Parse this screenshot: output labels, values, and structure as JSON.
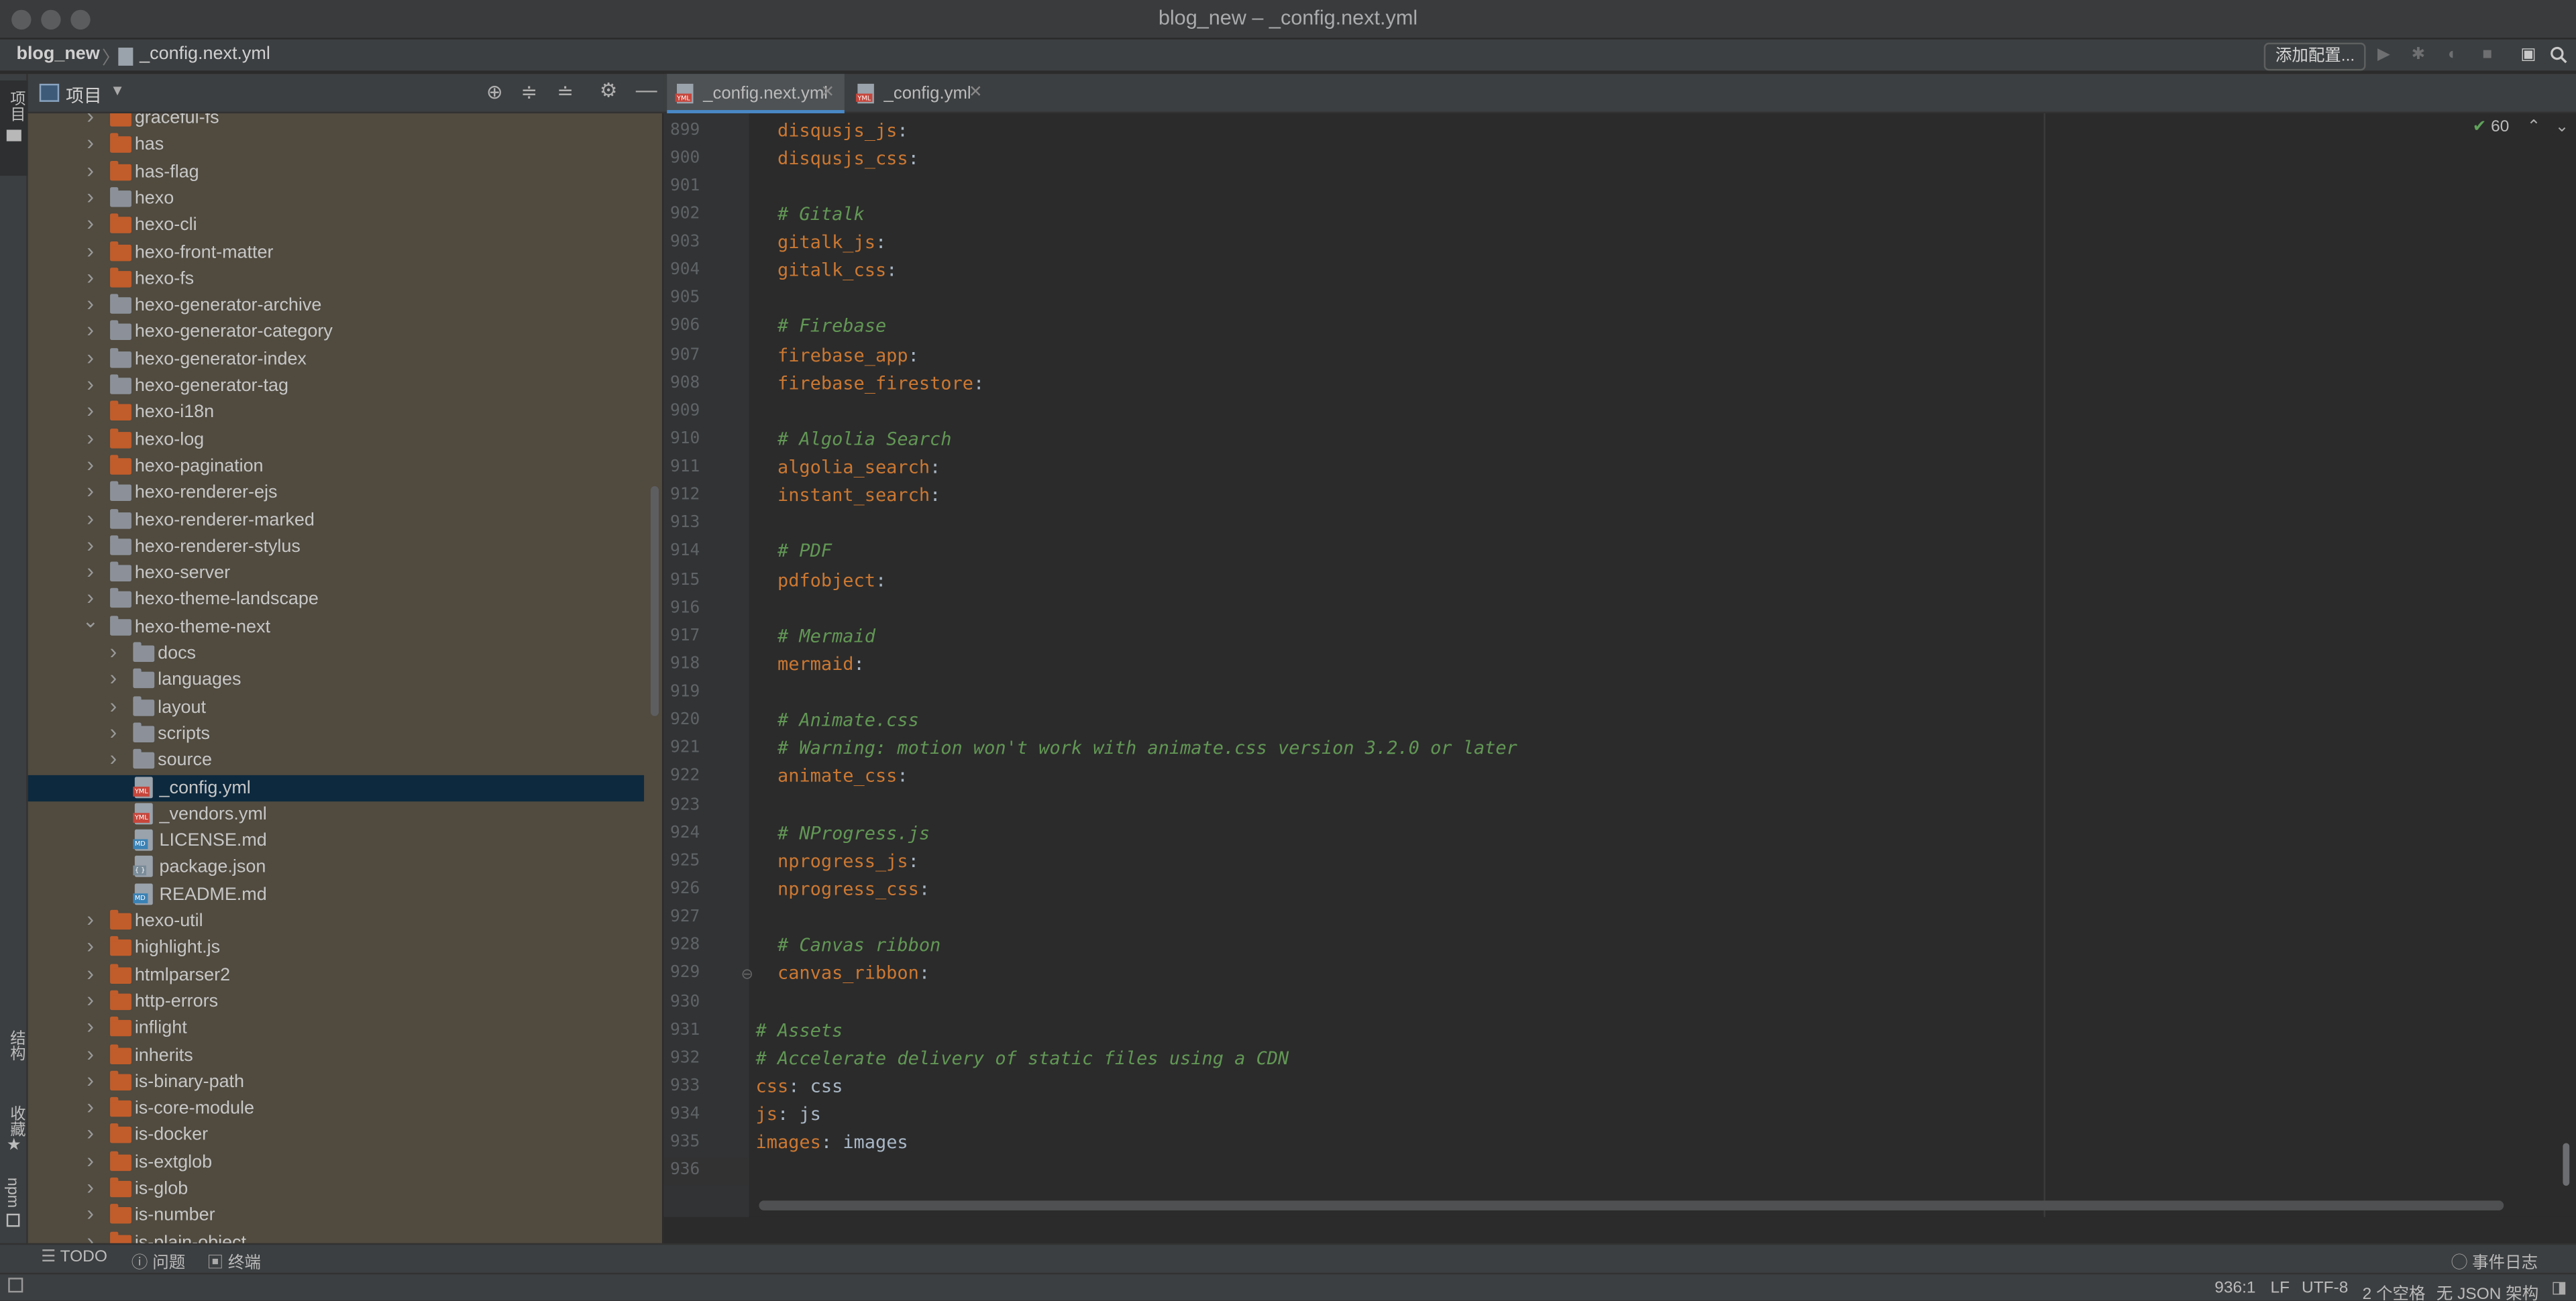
{
  "window": {
    "title": "blog_new – _config.next.yml"
  },
  "breadcrumb": {
    "project": "blog_new",
    "file": "_config.next.yml"
  },
  "toolbar": {
    "add_config": "添加配置..."
  },
  "left_strip": {
    "project_tab": "项目",
    "structure_tab": "结构",
    "favorites_tab": "收藏",
    "npm_tab": "npm"
  },
  "project_panel": {
    "title": "项目",
    "items": [
      {
        "label": "graceful-fs",
        "level": 0,
        "kind": "folder-orange",
        "chevron": "right"
      },
      {
        "label": "has",
        "level": 0,
        "kind": "folder-orange",
        "chevron": "right"
      },
      {
        "label": "has-flag",
        "level": 0,
        "kind": "folder-orange",
        "chevron": "right"
      },
      {
        "label": "hexo",
        "level": 0,
        "kind": "folder-gray",
        "chevron": "right"
      },
      {
        "label": "hexo-cli",
        "level": 0,
        "kind": "folder-orange",
        "chevron": "right"
      },
      {
        "label": "hexo-front-matter",
        "level": 0,
        "kind": "folder-orange",
        "chevron": "right"
      },
      {
        "label": "hexo-fs",
        "level": 0,
        "kind": "folder-orange",
        "chevron": "right"
      },
      {
        "label": "hexo-generator-archive",
        "level": 0,
        "kind": "folder-gray",
        "chevron": "right"
      },
      {
        "label": "hexo-generator-category",
        "level": 0,
        "kind": "folder-gray",
        "chevron": "right"
      },
      {
        "label": "hexo-generator-index",
        "level": 0,
        "kind": "folder-gray",
        "chevron": "right"
      },
      {
        "label": "hexo-generator-tag",
        "level": 0,
        "kind": "folder-gray",
        "chevron": "right"
      },
      {
        "label": "hexo-i18n",
        "level": 0,
        "kind": "folder-orange",
        "chevron": "right"
      },
      {
        "label": "hexo-log",
        "level": 0,
        "kind": "folder-orange",
        "chevron": "right"
      },
      {
        "label": "hexo-pagination",
        "level": 0,
        "kind": "folder-orange",
        "chevron": "right"
      },
      {
        "label": "hexo-renderer-ejs",
        "level": 0,
        "kind": "folder-gray",
        "chevron": "right"
      },
      {
        "label": "hexo-renderer-marked",
        "level": 0,
        "kind": "folder-gray",
        "chevron": "right"
      },
      {
        "label": "hexo-renderer-stylus",
        "level": 0,
        "kind": "folder-gray",
        "chevron": "right"
      },
      {
        "label": "hexo-server",
        "level": 0,
        "kind": "folder-gray",
        "chevron": "right"
      },
      {
        "label": "hexo-theme-landscape",
        "level": 0,
        "kind": "folder-gray",
        "chevron": "right"
      },
      {
        "label": "hexo-theme-next",
        "level": 0,
        "kind": "folder-gray",
        "chevron": "down"
      },
      {
        "label": "docs",
        "level": 1,
        "kind": "folder-gray",
        "chevron": "right"
      },
      {
        "label": "languages",
        "level": 1,
        "kind": "folder-gray",
        "chevron": "right"
      },
      {
        "label": "layout",
        "level": 1,
        "kind": "folder-gray",
        "chevron": "right"
      },
      {
        "label": "scripts",
        "level": 1,
        "kind": "folder-gray",
        "chevron": "right"
      },
      {
        "label": "source",
        "level": 1,
        "kind": "folder-gray",
        "chevron": "right"
      },
      {
        "label": "_config.yml",
        "level": 1,
        "kind": "file-yml",
        "chevron": "none",
        "selected": true
      },
      {
        "label": "_vendors.yml",
        "level": 1,
        "kind": "file-yml",
        "chevron": "none"
      },
      {
        "label": "LICENSE.md",
        "level": 1,
        "kind": "file-md",
        "chevron": "none"
      },
      {
        "label": "package.json",
        "level": 1,
        "kind": "file-json",
        "chevron": "none"
      },
      {
        "label": "README.md",
        "level": 1,
        "kind": "file-md",
        "chevron": "none"
      },
      {
        "label": "hexo-util",
        "level": 0,
        "kind": "folder-orange",
        "chevron": "right"
      },
      {
        "label": "highlight.js",
        "level": 0,
        "kind": "folder-orange",
        "chevron": "right"
      },
      {
        "label": "htmlparser2",
        "level": 0,
        "kind": "folder-orange",
        "chevron": "right"
      },
      {
        "label": "http-errors",
        "level": 0,
        "kind": "folder-orange",
        "chevron": "right"
      },
      {
        "label": "inflight",
        "level": 0,
        "kind": "folder-orange",
        "chevron": "right"
      },
      {
        "label": "inherits",
        "level": 0,
        "kind": "folder-orange",
        "chevron": "right"
      },
      {
        "label": "is-binary-path",
        "level": 0,
        "kind": "folder-orange",
        "chevron": "right"
      },
      {
        "label": "is-core-module",
        "level": 0,
        "kind": "folder-orange",
        "chevron": "right"
      },
      {
        "label": "is-docker",
        "level": 0,
        "kind": "folder-orange",
        "chevron": "right"
      },
      {
        "label": "is-extglob",
        "level": 0,
        "kind": "folder-orange",
        "chevron": "right"
      },
      {
        "label": "is-glob",
        "level": 0,
        "kind": "folder-orange",
        "chevron": "right"
      },
      {
        "label": "is-number",
        "level": 0,
        "kind": "folder-orange",
        "chevron": "right"
      },
      {
        "label": "is-plain-object",
        "level": 0,
        "kind": "folder-orange",
        "chevron": "right"
      }
    ]
  },
  "tabs": [
    {
      "label": "_config.next.yml",
      "active": true
    },
    {
      "label": "_config.yml",
      "active": false
    }
  ],
  "editor": {
    "inspection_count": "60",
    "lines": [
      {
        "n": "899",
        "parts": [
          {
            "t": "  "
          },
          {
            "t": "disqusjs_js",
            "c": "k"
          },
          {
            "t": ":",
            "c": "p"
          }
        ]
      },
      {
        "n": "900",
        "parts": [
          {
            "t": "  "
          },
          {
            "t": "disqusjs_css",
            "c": "k"
          },
          {
            "t": ":",
            "c": "p"
          }
        ]
      },
      {
        "n": "901",
        "parts": []
      },
      {
        "n": "902",
        "parts": [
          {
            "t": "  "
          },
          {
            "t": "# Gitalk",
            "c": "c"
          }
        ]
      },
      {
        "n": "903",
        "parts": [
          {
            "t": "  "
          },
          {
            "t": "gitalk_js",
            "c": "k"
          },
          {
            "t": ":",
            "c": "p"
          }
        ]
      },
      {
        "n": "904",
        "parts": [
          {
            "t": "  "
          },
          {
            "t": "gitalk_css",
            "c": "k"
          },
          {
            "t": ":",
            "c": "p"
          }
        ]
      },
      {
        "n": "905",
        "parts": []
      },
      {
        "n": "906",
        "parts": [
          {
            "t": "  "
          },
          {
            "t": "# Firebase",
            "c": "c"
          }
        ]
      },
      {
        "n": "907",
        "parts": [
          {
            "t": "  "
          },
          {
            "t": "firebase_app",
            "c": "k"
          },
          {
            "t": ":",
            "c": "p"
          }
        ]
      },
      {
        "n": "908",
        "parts": [
          {
            "t": "  "
          },
          {
            "t": "firebase_firestore",
            "c": "k"
          },
          {
            "t": ":",
            "c": "p"
          }
        ]
      },
      {
        "n": "909",
        "parts": []
      },
      {
        "n": "910",
        "parts": [
          {
            "t": "  "
          },
          {
            "t": "# Algolia Search",
            "c": "c"
          }
        ]
      },
      {
        "n": "911",
        "parts": [
          {
            "t": "  "
          },
          {
            "t": "algolia_search",
            "c": "k"
          },
          {
            "t": ":",
            "c": "p"
          }
        ]
      },
      {
        "n": "912",
        "parts": [
          {
            "t": "  "
          },
          {
            "t": "instant_search",
            "c": "k"
          },
          {
            "t": ":",
            "c": "p"
          }
        ]
      },
      {
        "n": "913",
        "parts": []
      },
      {
        "n": "914",
        "parts": [
          {
            "t": "  "
          },
          {
            "t": "# PDF",
            "c": "c"
          }
        ]
      },
      {
        "n": "915",
        "parts": [
          {
            "t": "  "
          },
          {
            "t": "pdfobject",
            "c": "k"
          },
          {
            "t": ":",
            "c": "p"
          }
        ]
      },
      {
        "n": "916",
        "parts": []
      },
      {
        "n": "917",
        "parts": [
          {
            "t": "  "
          },
          {
            "t": "# Mermaid",
            "c": "c"
          }
        ]
      },
      {
        "n": "918",
        "parts": [
          {
            "t": "  "
          },
          {
            "t": "mermaid",
            "c": "k"
          },
          {
            "t": ":",
            "c": "p"
          }
        ]
      },
      {
        "n": "919",
        "parts": []
      },
      {
        "n": "920",
        "parts": [
          {
            "t": "  "
          },
          {
            "t": "# Animate.css",
            "c": "c"
          }
        ]
      },
      {
        "n": "921",
        "parts": [
          {
            "t": "  "
          },
          {
            "t": "# Warning: motion won't work with animate.css version 3.2.0 or later",
            "c": "c"
          }
        ]
      },
      {
        "n": "922",
        "parts": [
          {
            "t": "  "
          },
          {
            "t": "animate_css",
            "c": "k"
          },
          {
            "t": ":",
            "c": "p"
          }
        ]
      },
      {
        "n": "923",
        "parts": []
      },
      {
        "n": "924",
        "parts": [
          {
            "t": "  "
          },
          {
            "t": "# NProgress.js",
            "c": "c"
          }
        ]
      },
      {
        "n": "925",
        "parts": [
          {
            "t": "  "
          },
          {
            "t": "nprogress_js",
            "c": "k"
          },
          {
            "t": ":",
            "c": "p"
          }
        ]
      },
      {
        "n": "926",
        "parts": [
          {
            "t": "  "
          },
          {
            "t": "nprogress_css",
            "c": "k"
          },
          {
            "t": ":",
            "c": "p"
          }
        ]
      },
      {
        "n": "927",
        "parts": []
      },
      {
        "n": "928",
        "parts": [
          {
            "t": "  "
          },
          {
            "t": "# Canvas ribbon",
            "c": "c"
          }
        ]
      },
      {
        "n": "929",
        "parts": [
          {
            "t": "  "
          },
          {
            "t": "canvas_ribbon",
            "c": "k"
          },
          {
            "t": ":",
            "c": "p"
          }
        ]
      },
      {
        "n": "930",
        "parts": []
      },
      {
        "n": "931",
        "parts": [
          {
            "t": "# Assets",
            "c": "c"
          }
        ]
      },
      {
        "n": "932",
        "parts": [
          {
            "t": "# Accelerate delivery of static files using a CDN",
            "c": "c"
          }
        ]
      },
      {
        "n": "933",
        "parts": [
          {
            "t": "css",
            "c": "k"
          },
          {
            "t": ": css",
            "c": "p"
          }
        ]
      },
      {
        "n": "934",
        "parts": [
          {
            "t": "js",
            "c": "k"
          },
          {
            "t": ": js",
            "c": "p"
          }
        ]
      },
      {
        "n": "935",
        "parts": [
          {
            "t": "images",
            "c": "k"
          },
          {
            "t": ": images",
            "c": "p"
          }
        ]
      },
      {
        "n": "936",
        "parts": []
      }
    ]
  },
  "bottom_tools": {
    "todo": "TODO",
    "problems": "问题",
    "terminal": "终端",
    "event_log": "事件日志"
  },
  "status": {
    "position": "936:1",
    "line_sep": "LF",
    "encoding": "UTF-8",
    "indent": "2 个空格",
    "schema": "无 JSON 架构"
  },
  "colors": {
    "selection": "#0d293e",
    "key": "#cc7832",
    "comment": "#629755",
    "folder_orange": "#c15d2b",
    "folder_gray": "#8c9199"
  }
}
